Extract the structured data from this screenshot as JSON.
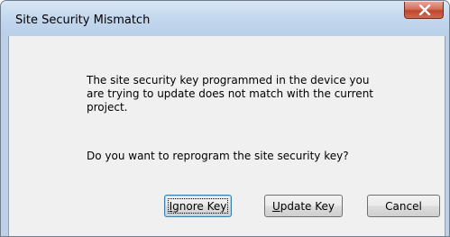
{
  "window": {
    "title": "Site Security Mismatch"
  },
  "titlebar": {
    "close_icon": "close-x-icon"
  },
  "dialog": {
    "message": "The site security key programmed in the device you are trying to update does not match with the current project.",
    "question": "Do you want to reprogram the site security key?"
  },
  "buttons": {
    "ignore": {
      "mnemonic": "I",
      "rest": "gnore Key"
    },
    "update": {
      "mnemonic": "U",
      "rest": "pdate Key"
    },
    "cancel": {
      "label": "Cancel"
    }
  },
  "colors": {
    "titlebar": "#c4d8ee",
    "client": "#f0f0f0",
    "close_button": "#c0452c",
    "default_button_border": "#3c7fb1"
  }
}
